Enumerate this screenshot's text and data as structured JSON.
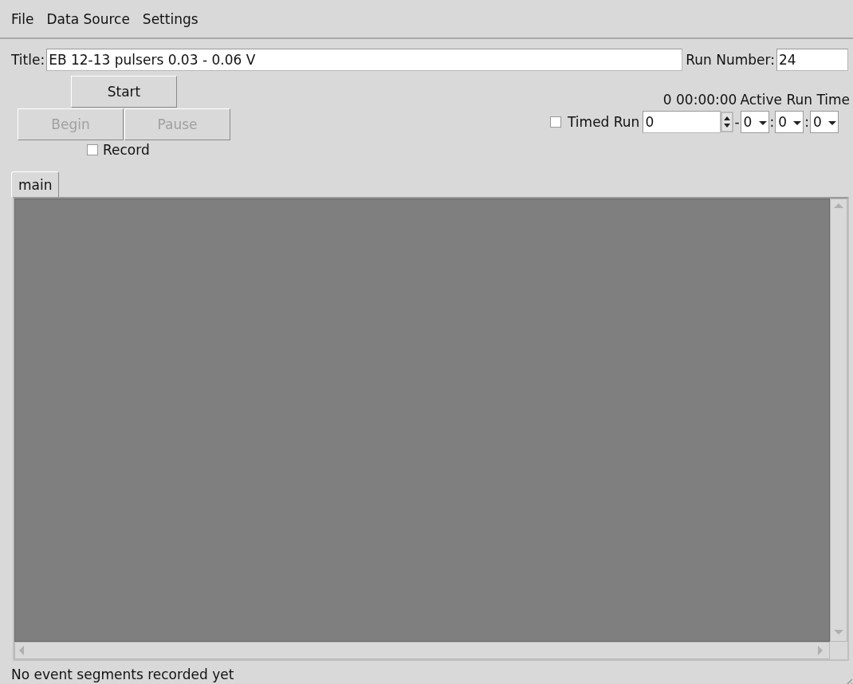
{
  "menu": [
    {
      "label": "File"
    },
    {
      "label": "Data Source"
    },
    {
      "label": "Settings"
    }
  ],
  "title_field": {
    "label": "Title:",
    "value": "EB 12-13 pulsers 0.03 - 0.06 V"
  },
  "run_number": {
    "label": "Run Number:",
    "value": "24"
  },
  "buttons": [
    {
      "label": "Start",
      "disabled": false
    },
    {
      "label": "Begin",
      "disabled": true
    },
    {
      "label": "Pause",
      "disabled": true
    }
  ],
  "record": {
    "label": "Record",
    "checked": false
  },
  "active_run_time": {
    "value": "0 00:00:00",
    "label": "Active Run Time"
  },
  "timed_run": {
    "label": "Timed Run",
    "checked": false,
    "fields": [
      {
        "kind": "spin",
        "value": "0"
      },
      {
        "kind": "separator",
        "text": "-"
      },
      {
        "kind": "combo",
        "value": "0"
      },
      {
        "kind": "separator",
        "text": ":"
      },
      {
        "kind": "combo",
        "value": "0"
      },
      {
        "kind": "separator",
        "text": ":"
      },
      {
        "kind": "combo",
        "value": "0"
      }
    ]
  },
  "tabs": [
    {
      "label": "main",
      "selected": true
    }
  ],
  "status_bar": "No event segments recorded yet"
}
